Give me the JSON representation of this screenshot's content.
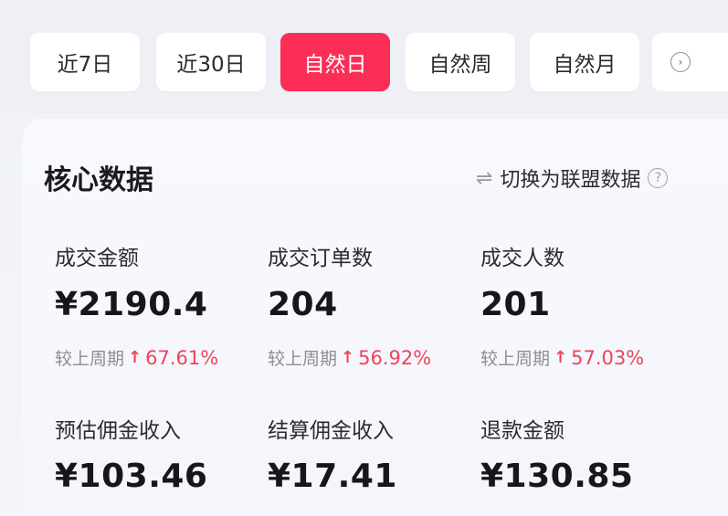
{
  "tabs": [
    {
      "label": "近7日",
      "active": false
    },
    {
      "label": "近30日",
      "active": false
    },
    {
      "label": "自然日",
      "active": true
    },
    {
      "label": "自然周",
      "active": false
    },
    {
      "label": "自然月",
      "active": false
    }
  ],
  "more_icon": "chevron-right-circle-icon",
  "section": {
    "title": "核心数据",
    "switch_label": "切换为联盟数据",
    "switch_icon": "swap-arrows-icon",
    "help_icon": "question-circle-icon"
  },
  "metrics": [
    {
      "label": "成交金额",
      "value": "¥2190.4",
      "compare_label": "较上周期",
      "compare_value": "67.61%",
      "trend": "up"
    },
    {
      "label": "成交订单数",
      "value": "204",
      "compare_label": "较上周期",
      "compare_value": "56.92%",
      "trend": "up"
    },
    {
      "label": "成交人数",
      "value": "201",
      "compare_label": "较上周期",
      "compare_value": "57.03%",
      "trend": "up"
    },
    {
      "label": "预估佣金收入",
      "value": "¥103.46"
    },
    {
      "label": "结算佣金收入",
      "value": "¥17.41"
    },
    {
      "label": "退款金额",
      "value": "¥130.85"
    }
  ],
  "colors": {
    "accent": "#fb2e55",
    "trend_up": "#f0435a"
  }
}
